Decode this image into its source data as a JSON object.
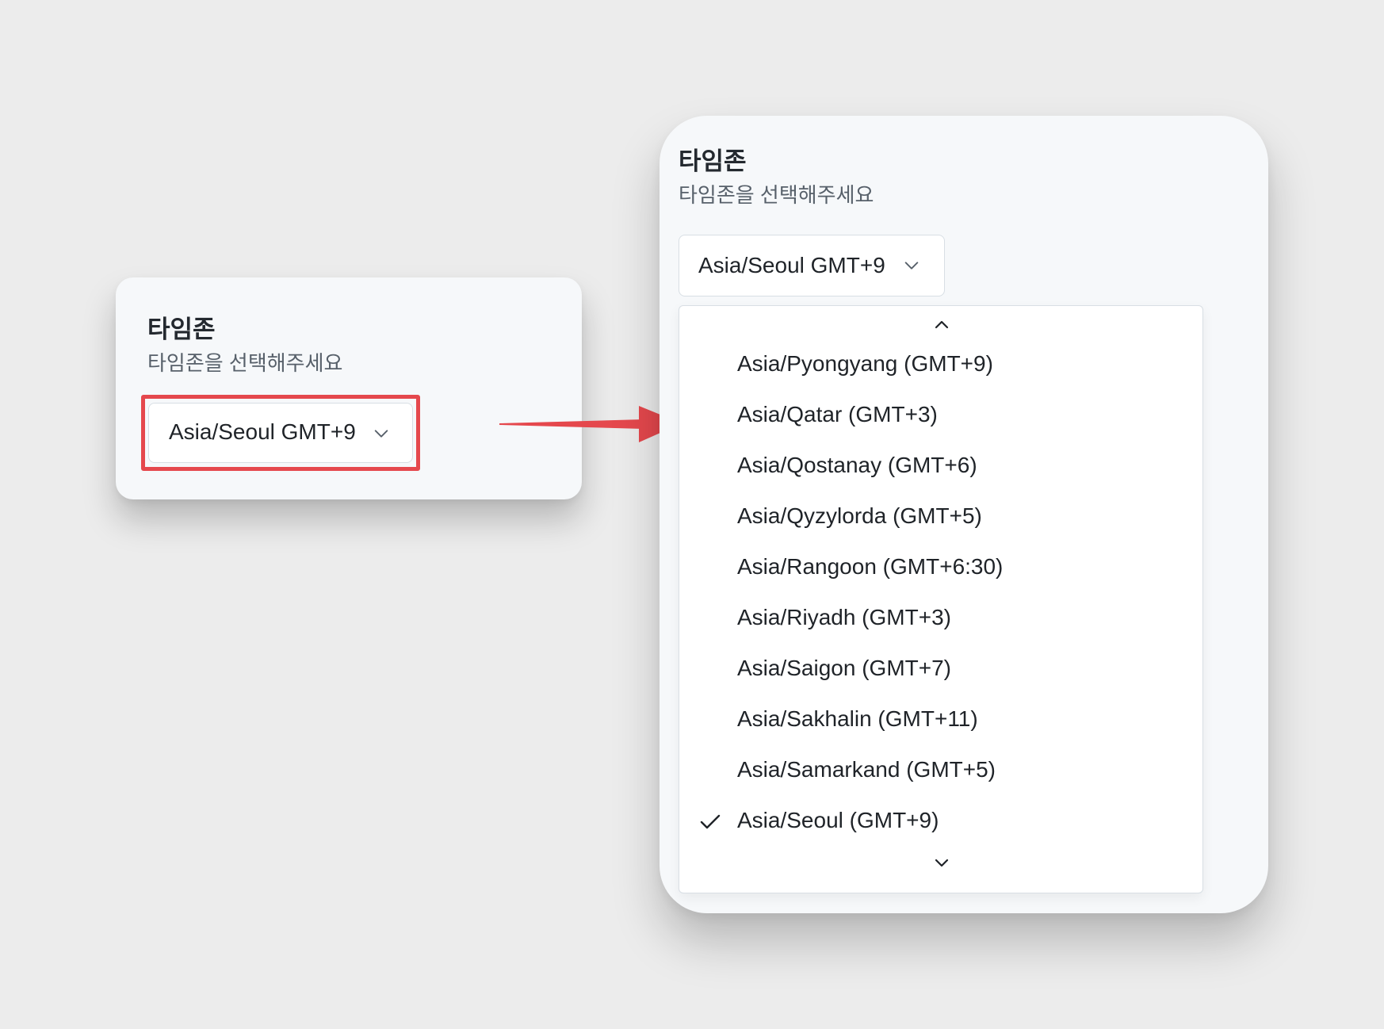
{
  "left_card": {
    "title": "타임존",
    "subtitle": "타임존을 선택해주세요",
    "select_value": "Asia/Seoul GMT+9",
    "select_icon": "chevron-down-icon",
    "highlight_color": "#e5484d"
  },
  "arrow": {
    "color": "#e5484d",
    "icon": "arrow-right-icon"
  },
  "right_card": {
    "title": "타임존",
    "subtitle": "타임존을 선택해주세요",
    "select_value": "Asia/Seoul GMT+9",
    "select_icon": "chevron-down-icon",
    "dropdown": {
      "scroll_up_icon": "chevron-up-icon",
      "scroll_down_icon": "chevron-down-icon",
      "options": [
        {
          "label": "Asia/Pyongyang (GMT+9)",
          "selected": false
        },
        {
          "label": "Asia/Qatar (GMT+3)",
          "selected": false
        },
        {
          "label": "Asia/Qostanay (GMT+6)",
          "selected": false
        },
        {
          "label": "Asia/Qyzylorda (GMT+5)",
          "selected": false
        },
        {
          "label": "Asia/Rangoon (GMT+6:30)",
          "selected": false
        },
        {
          "label": "Asia/Riyadh (GMT+3)",
          "selected": false
        },
        {
          "label": "Asia/Saigon (GMT+7)",
          "selected": false
        },
        {
          "label": "Asia/Sakhalin (GMT+11)",
          "selected": false
        },
        {
          "label": "Asia/Samarkand (GMT+5)",
          "selected": false
        },
        {
          "label": "Asia/Seoul (GMT+9)",
          "selected": true
        }
      ]
    }
  }
}
